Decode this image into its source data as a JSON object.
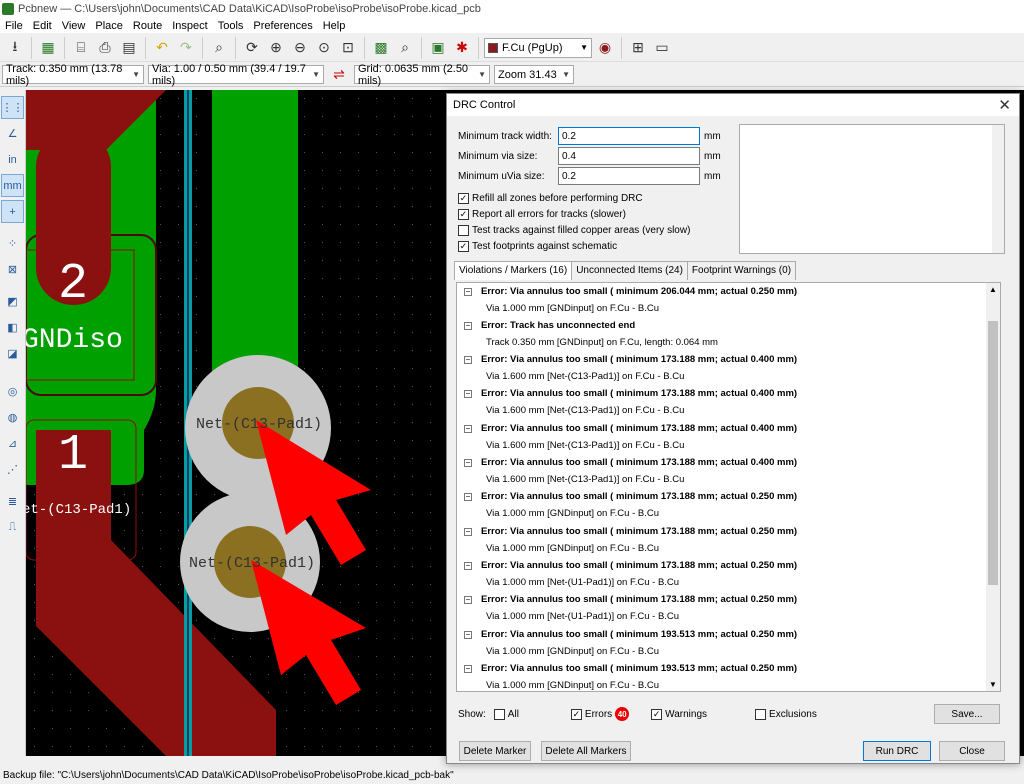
{
  "window": {
    "title": "Pcbnew — C:\\Users\\john\\Documents\\CAD Data\\KiCAD\\IsoProbe\\isoProbe\\isoProbe.kicad_pcb"
  },
  "menu": [
    "File",
    "Edit",
    "View",
    "Place",
    "Route",
    "Inspect",
    "Tools",
    "Preferences",
    "Help"
  ],
  "toolbar": {
    "layer": "F.Cu (PgUp)",
    "layer_color": "#8b1a1a"
  },
  "toolbar2": {
    "track": "Track: 0.350 mm (13.78 mils)",
    "via": "Via: 1.00 / 0.50 mm (39.4 / 19.7 mils)",
    "grid": "Grid: 0.0635 mm (2.50 mils)",
    "zoom": "Zoom 31.43"
  },
  "left_toolbar": {
    "inch": "in",
    "mm": "mm"
  },
  "canvas": {
    "pad2_number": "2",
    "pad2_net": "GNDiso",
    "pad1_number": "1",
    "pad1_net": "et-(C13-Pad1)",
    "via1_net": "Net-(C13-Pad1)",
    "via2_net": "Net-(C13-Pad1)",
    "colors": {
      "fcu": "#8b1010",
      "bcu": "#00a000",
      "via": "#c8c8c8",
      "drill": "#8a7020",
      "arrow": "#ff0000",
      "edge": "#00a0a0"
    }
  },
  "status": {
    "backup": "Backup file: \"C:\\Users\\john\\Documents\\CAD Data\\KiCAD\\IsoProbe\\isoProbe\\isoProbe.kicad_pcb-bak\""
  },
  "dialog": {
    "title": "DRC Control",
    "fields": [
      {
        "label": "Minimum track width:",
        "value": "0.2",
        "unit": "mm"
      },
      {
        "label": "Minimum via size:",
        "value": "0.4",
        "unit": "mm"
      },
      {
        "label": "Minimum uVia size:",
        "value": "0.2",
        "unit": "mm"
      }
    ],
    "options": [
      {
        "label": "Refill all zones before performing DRC",
        "checked": true
      },
      {
        "label": "Report all errors for tracks (slower)",
        "checked": true
      },
      {
        "label": "Test tracks against filled copper areas (very slow)",
        "checked": false
      },
      {
        "label": "Test footprints against schematic",
        "checked": true
      }
    ],
    "tabs": [
      "Violations / Markers (16)",
      "Unconnected Items (24)",
      "Footprint Warnings (0)"
    ],
    "violations": [
      {
        "error": "Error: Via annulus too small ( minimum 206.044 mm; actual 0.250 mm)",
        "detail": "Via 1.000 mm [GNDinput] on F.Cu - B.Cu"
      },
      {
        "error": "Error: Track has unconnected end",
        "detail": "Track 0.350 mm [GNDinput] on F.Cu, length: 0.064 mm"
      },
      {
        "error": "Error: Via annulus too small ( minimum 173.188 mm; actual 0.400 mm)",
        "detail": "Via 1.600 mm [Net-(C13-Pad1)] on F.Cu - B.Cu"
      },
      {
        "error": "Error: Via annulus too small ( minimum 173.188 mm; actual 0.400 mm)",
        "detail": "Via 1.600 mm [Net-(C13-Pad1)] on F.Cu - B.Cu"
      },
      {
        "error": "Error: Via annulus too small ( minimum 173.188 mm; actual 0.400 mm)",
        "detail": "Via 1.600 mm [Net-(C13-Pad1)] on F.Cu - B.Cu"
      },
      {
        "error": "Error: Via annulus too small ( minimum 173.188 mm; actual 0.400 mm)",
        "detail": "Via 1.600 mm [Net-(C13-Pad1)] on F.Cu - B.Cu"
      },
      {
        "error": "Error: Via annulus too small ( minimum 173.188 mm; actual 0.250 mm)",
        "detail": "Via 1.000 mm [GNDinput] on F.Cu - B.Cu"
      },
      {
        "error": "Error: Via annulus too small ( minimum 173.188 mm; actual 0.250 mm)",
        "detail": "Via 1.000 mm [GNDinput] on F.Cu - B.Cu"
      },
      {
        "error": "Error: Via annulus too small ( minimum 173.188 mm; actual 0.250 mm)",
        "detail": "Via 1.000 mm [Net-(U1-Pad1)] on F.Cu - B.Cu"
      },
      {
        "error": "Error: Via annulus too small ( minimum 173.188 mm; actual 0.250 mm)",
        "detail": "Via 1.000 mm [Net-(U1-Pad1)] on F.Cu - B.Cu"
      },
      {
        "error": "Error: Via annulus too small ( minimum 193.513 mm; actual 0.250 mm)",
        "detail": "Via 1.000 mm [GNDinput] on F.Cu - B.Cu"
      },
      {
        "error": "Error: Via annulus too small ( minimum 193.513 mm; actual 0.250 mm)",
        "detail": "Via 1.000 mm [GNDinput] on F.Cu - B.Cu"
      }
    ],
    "show": {
      "label": "Show:",
      "all": {
        "label": "All",
        "checked": false
      },
      "errors": {
        "label": "Errors",
        "checked": true,
        "count": "40"
      },
      "warnings": {
        "label": "Warnings",
        "checked": true
      },
      "exclusions": {
        "label": "Exclusions",
        "checked": false
      }
    },
    "buttons": {
      "save": "Save...",
      "delete_marker": "Delete Marker",
      "delete_all": "Delete All Markers",
      "run": "Run DRC",
      "close": "Close"
    }
  }
}
